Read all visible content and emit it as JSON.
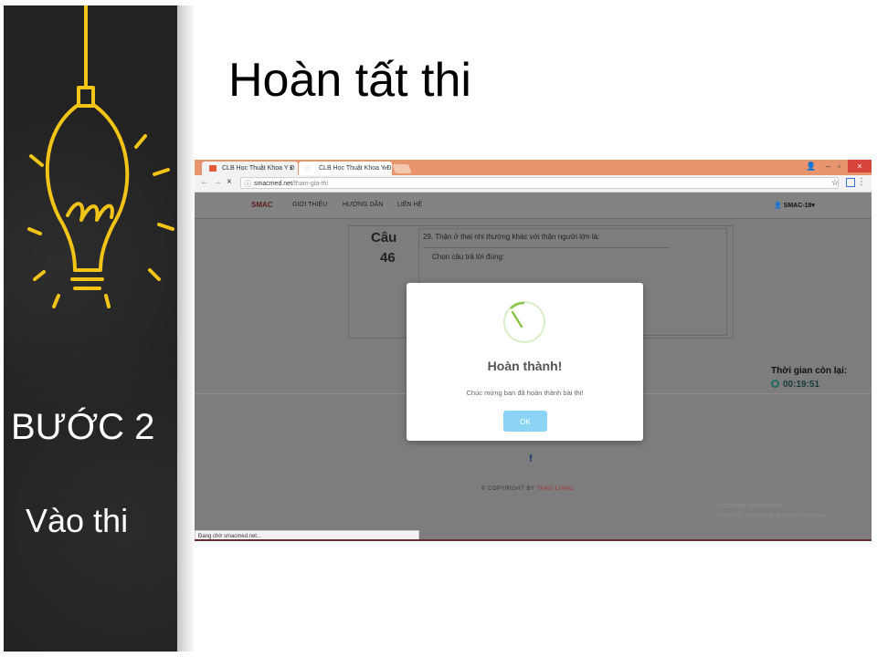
{
  "slide": {
    "title": "Hoàn tất thi",
    "step": "BƯỚC 2",
    "step_sub": "Vào thi"
  },
  "browser": {
    "tabs": [
      {
        "label": "CLB Học Thuật Khoa Y Đ"
      },
      {
        "label": "CLB Học Thuật Khoa Y Đ"
      }
    ],
    "url_host": "smacmed.net",
    "url_path": "/tham-gia-thi",
    "status_text": "Đang chờ smacmed.net..."
  },
  "site": {
    "logo": "SMAC",
    "nav": [
      "GIỚI THIỆU",
      "HƯỚNG DẪN",
      "LIÊN HỆ"
    ],
    "user": "SMAC-18"
  },
  "question": {
    "label": "Câu",
    "number": "46",
    "text": "29. Thận ở thai nhi thường khác với thận người lớn là:",
    "instruction": "Chọn câu trả lời đúng:"
  },
  "timer": {
    "label": "Thời gian còn lại:",
    "value": "00:19:51"
  },
  "footer": {
    "copyright": "© COPYRIGHT BY",
    "author": "TANG LIANG",
    "facebook_icon": "f"
  },
  "watermark": {
    "line1": "Activate Windows",
    "line2": "Go to PC settings to activate Windows."
  },
  "modal": {
    "title": "Hoàn thành!",
    "message": "Chúc mừng bạn đã hoàn thành bài thi!",
    "ok_label": "OK"
  },
  "colors": {
    "accent_bulb": "#f2c417",
    "tab_bar": "#e8956d",
    "ok_button": "#8cd4f5",
    "spinner": "#8bc34a"
  }
}
